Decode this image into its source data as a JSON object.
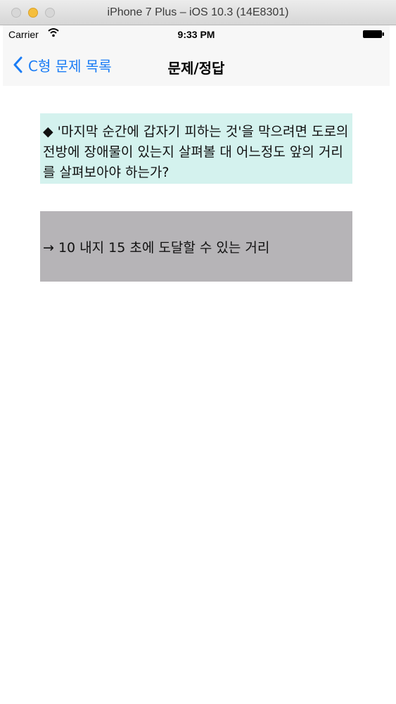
{
  "window": {
    "title": "iPhone 7 Plus – iOS 10.3 (14E8301)"
  },
  "status_bar": {
    "carrier": "Carrier",
    "time": "9:33 PM"
  },
  "nav": {
    "back_label": "C형 문제 목록",
    "title": "문제/정답"
  },
  "content": {
    "question": "◆ '마지막 순간에 갑자기 피하는 것'을 막으려면 도로의 전방에 장애물이 있는지 살펴볼 대 어느정도 앞의 거리를 살펴보아야 하는가?",
    "answer": "→ 10 내지 15 초에 도달할 수 있는 거리"
  },
  "colors": {
    "accent": "#1a7cf5",
    "question_bg": "#d4f2ee",
    "answer_bg": "#b6b4b7"
  }
}
